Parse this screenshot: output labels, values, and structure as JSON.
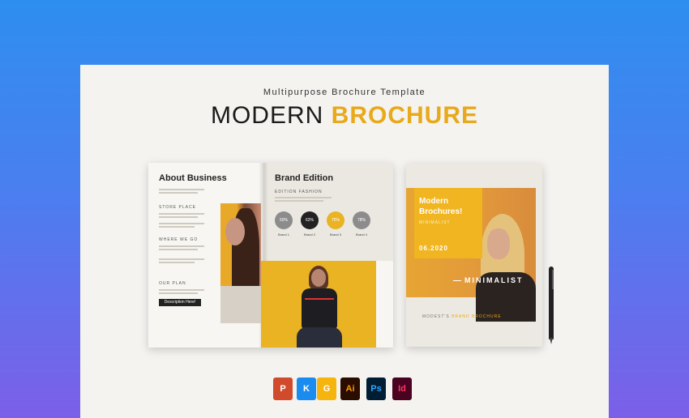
{
  "header": {
    "subtitle": "Multipurpose Brochure Template",
    "title_part1": "MODERN",
    "title_part2": "BROCHURE"
  },
  "left_spread": {
    "left_page": {
      "heading": "About Business",
      "sections": [
        "STORE PLACE",
        "WHERE WE GO",
        "OUR PLAN"
      ],
      "button_label": "Description Here!"
    },
    "right_page": {
      "heading": "Brand Edition",
      "caption": "EDITION FASHION",
      "circles": [
        {
          "value": "50%",
          "label": "Brand 1",
          "color": "#8c8c8c"
        },
        {
          "value": "62%",
          "label": "Brand 2",
          "color": "#222222"
        },
        {
          "value": "75%",
          "label": "Brand 3",
          "color": "#e9b323"
        },
        {
          "value": "78%",
          "label": "Brand 4",
          "color": "#8c8c8c"
        }
      ]
    }
  },
  "cover": {
    "headline_line1": "Modern",
    "headline_line2": "Brochures!",
    "sub": "MINIMALIST",
    "date": "06.2020",
    "badge": "MINIMALIST",
    "footer_part1": "MODEST'S",
    "footer_part2": "BRAND BROCHURE"
  },
  "apps": [
    {
      "label": "P",
      "bg": "#d04a2b",
      "fg": "#ffffff",
      "name": "powerpoint-icon"
    },
    {
      "label": "K",
      "bg": "#1a8cf0",
      "fg": "#ffffff",
      "name": "keynote-icon"
    },
    {
      "label": "G",
      "bg": "#f6b40e",
      "fg": "#ffffff",
      "name": "google-slides-icon"
    },
    {
      "label": "Ai",
      "bg": "#2b0d00",
      "fg": "#ff9a00",
      "name": "illustrator-icon"
    },
    {
      "label": "Ps",
      "bg": "#001d34",
      "fg": "#31a8ff",
      "name": "photoshop-icon"
    },
    {
      "label": "Id",
      "bg": "#49021f",
      "fg": "#ff3366",
      "name": "indesign-icon"
    }
  ]
}
